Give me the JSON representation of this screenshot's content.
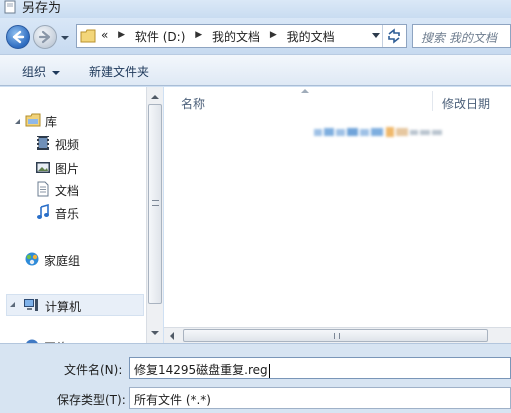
{
  "window": {
    "title": "另存为"
  },
  "address": {
    "overflow": "«",
    "crumbs": [
      "软件 (D:)",
      "我的文档",
      "我的文档"
    ],
    "separator": "▶"
  },
  "search": {
    "placeholder": "搜索 我的文档"
  },
  "toolbar": {
    "organize": "组织",
    "new_folder": "新建文件夹"
  },
  "nav": {
    "library": "库",
    "videos": "视频",
    "pictures": "图片",
    "documents": "文档",
    "music": "音乐",
    "homegroup": "家庭组",
    "computer": "计算机",
    "network_partial": "网络"
  },
  "files": {
    "col_name": "名称",
    "col_modified": "修改日期"
  },
  "form": {
    "filename_label": "文件名(N):",
    "filename_value": "修复14295磁盘重复.reg",
    "filetype_label": "保存类型(T):",
    "filetype_value": "所有文件 (*.*)"
  }
}
